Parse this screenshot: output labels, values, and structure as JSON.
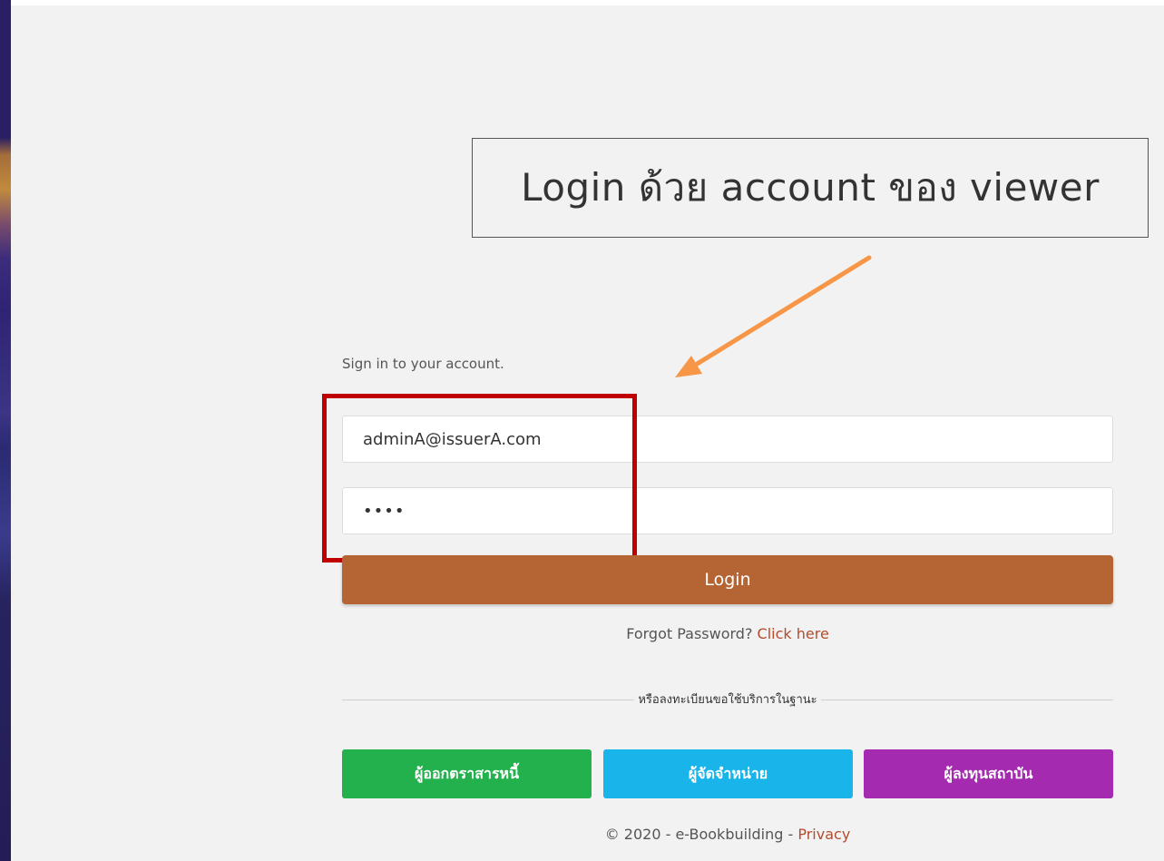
{
  "callout": {
    "text": "Login ด้วย account ของ viewer"
  },
  "login": {
    "subtitle": "Sign in to your account.",
    "email_value": "adminA@issuerA.com",
    "password_value": "••••",
    "login_label": "Login",
    "forgot_text": "Forgot Password?",
    "forgot_link": "Click here"
  },
  "register": {
    "divider_text": "หรือลงทะเบียนขอใช้บริการในฐานะ",
    "buttons": [
      {
        "label": "ผู้ออกตราสารหนี้",
        "color": "#22b14c"
      },
      {
        "label": "ผู้จัดจำหน่าย",
        "color": "#18b4ea"
      },
      {
        "label": "ผู้ลงทุนสถาบัน",
        "color": "#a42ab0"
      }
    ]
  },
  "footer": {
    "text": "© 2020 - e-Bookbuilding -",
    "privacy": "Privacy"
  },
  "colors": {
    "login_button": "#b56433",
    "highlight_box": "#c00000",
    "arrow": "#f79646",
    "link": "#b44b2d"
  }
}
